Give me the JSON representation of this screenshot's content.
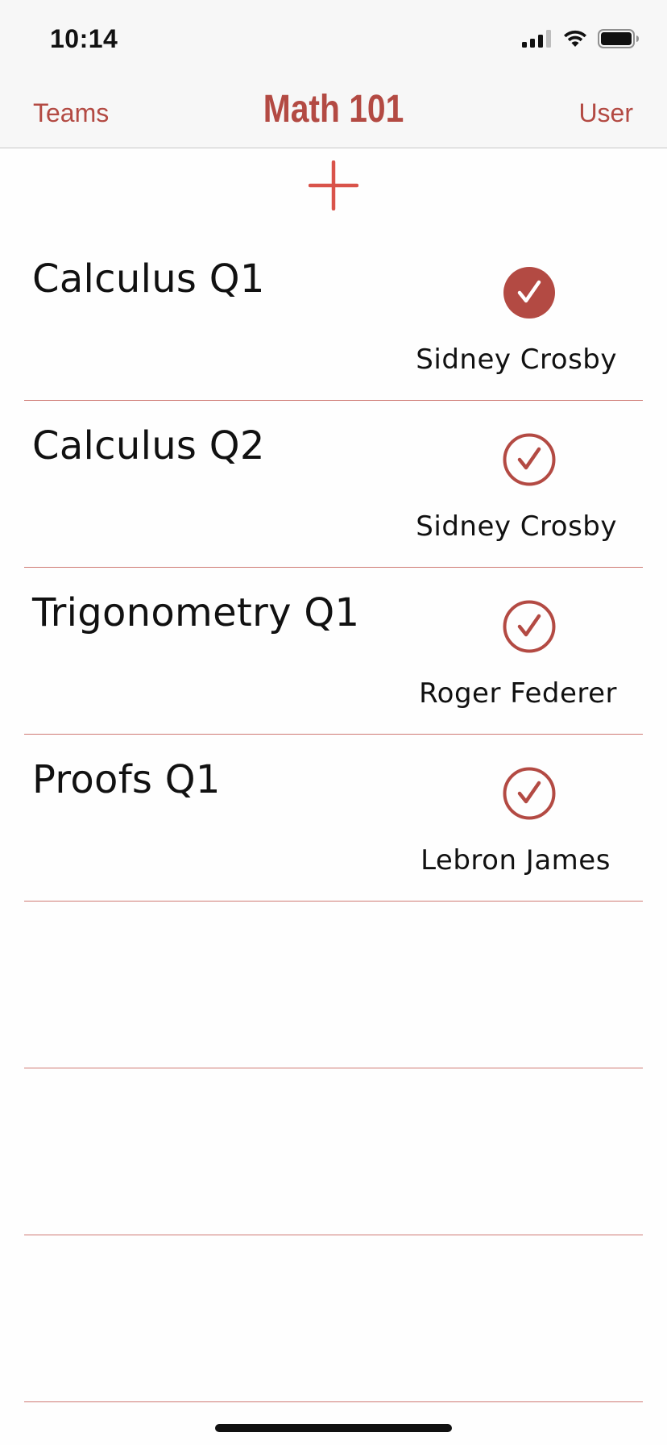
{
  "status_bar": {
    "time": "10:14",
    "icons": [
      "cellular-signal-icon",
      "wifi-icon",
      "battery-icon"
    ]
  },
  "nav": {
    "left_label": "Teams",
    "title": "Math 101",
    "right_label": "User"
  },
  "colors": {
    "accent": "#b34a43",
    "divider": "#cf7a74",
    "add_icon": "#d9534a"
  },
  "list": {
    "items": [
      {
        "title": "Calculus Q1",
        "assignee": "Sidney Crosby",
        "checked": true
      },
      {
        "title": "Calculus Q2",
        "assignee": "Sidney Crosby",
        "checked": false
      },
      {
        "title": "Trigonometry Q1",
        "assignee": "Roger Federer",
        "checked": false
      },
      {
        "title": "Proofs Q1",
        "assignee": "Lebron James",
        "checked": false
      },
      {
        "title": "",
        "assignee": "",
        "checked": null
      },
      {
        "title": "",
        "assignee": "",
        "checked": null
      },
      {
        "title": "",
        "assignee": "",
        "checked": null
      }
    ]
  }
}
